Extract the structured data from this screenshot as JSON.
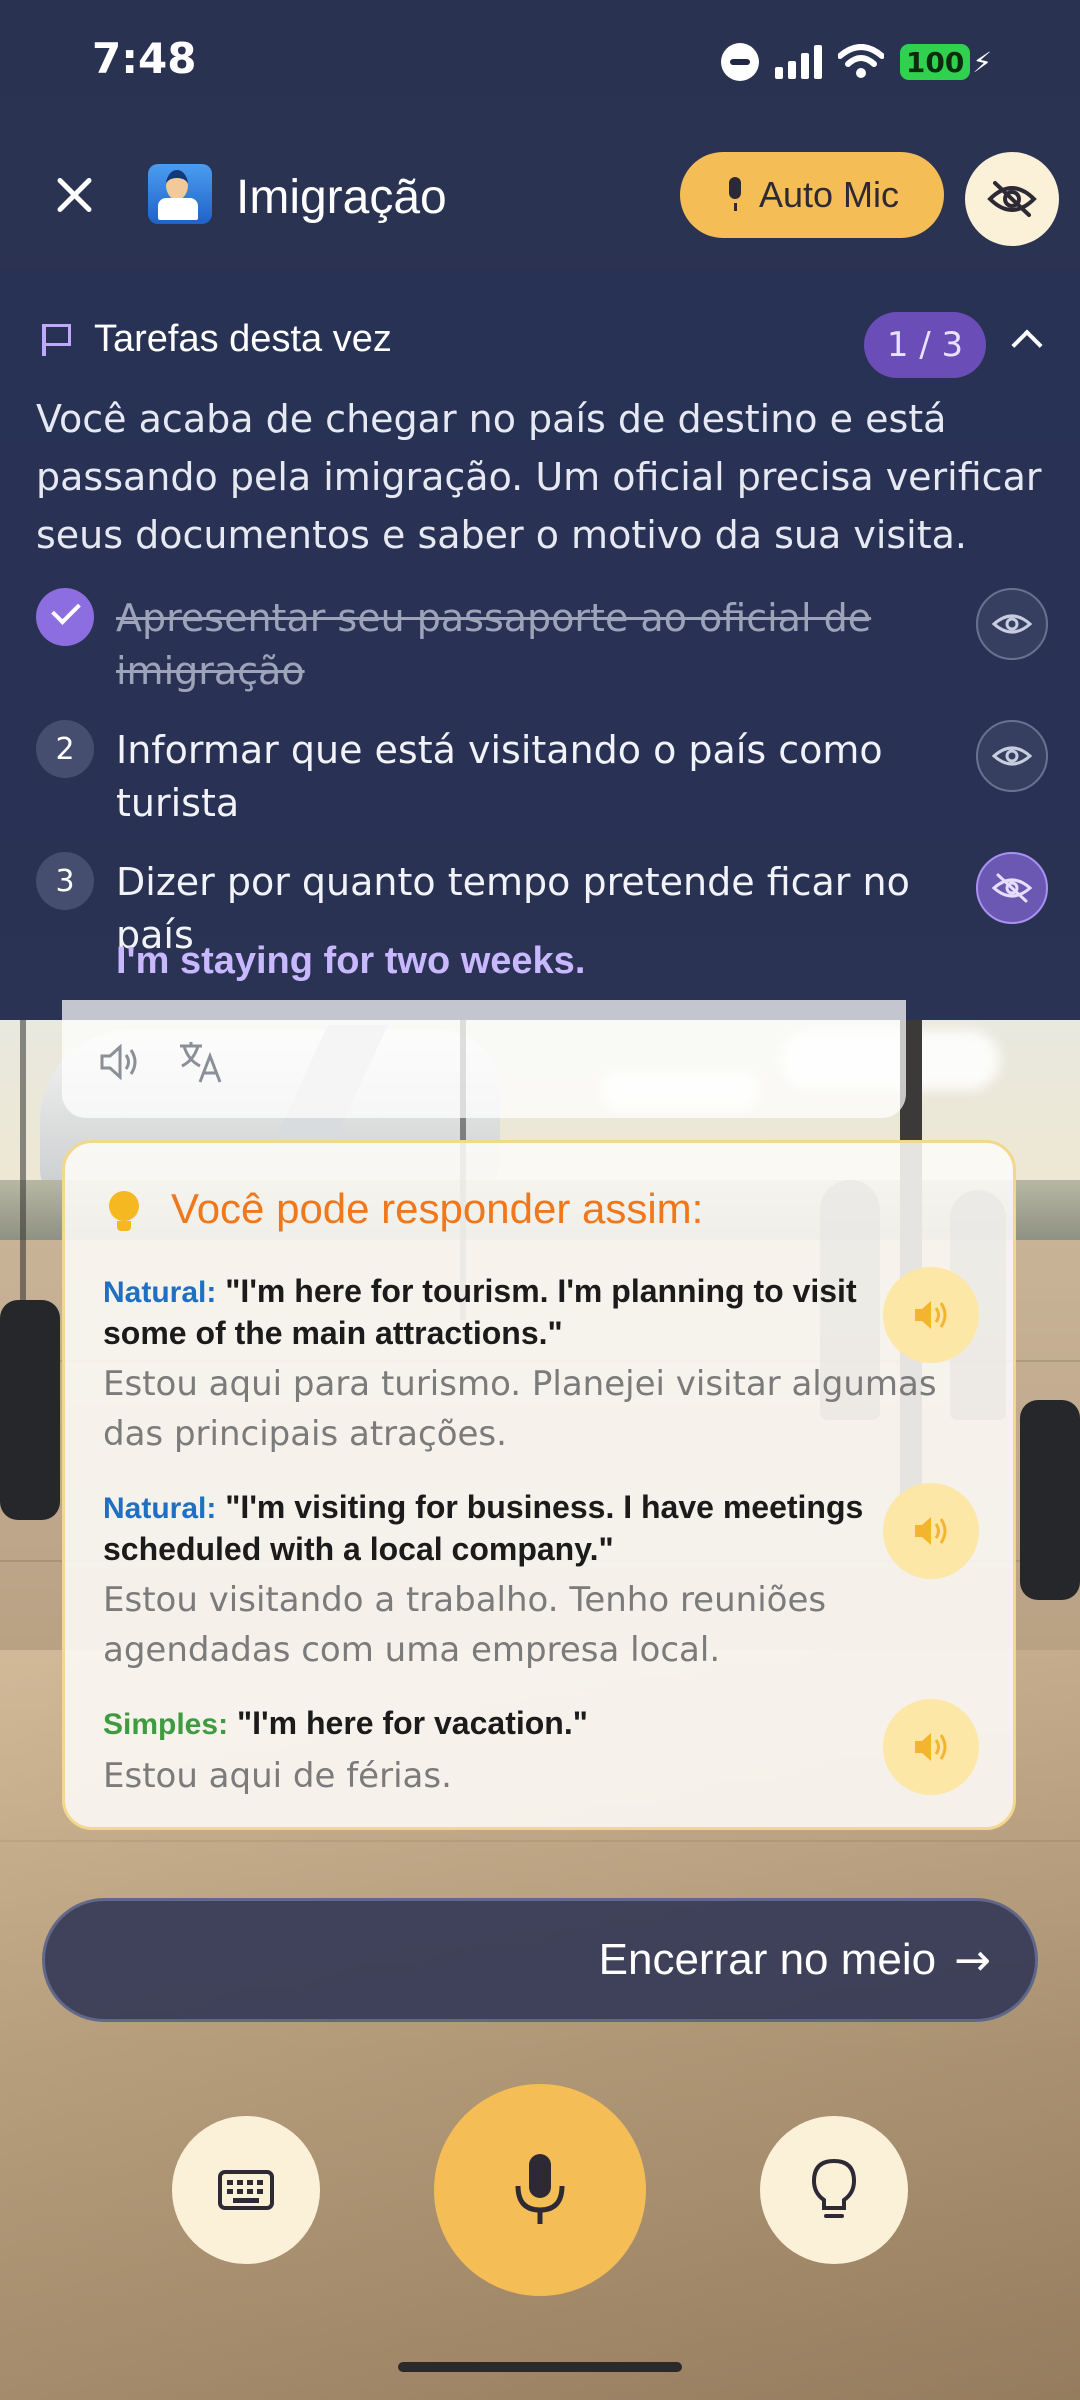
{
  "status_bar": {
    "time": "7:48",
    "battery": "100"
  },
  "header": {
    "title": "Imigração",
    "auto_mic_label": "Auto Mic"
  },
  "tasks": {
    "title": "Tarefas desta vez",
    "progress": "1 / 3",
    "description": "Você acaba de chegar no país de destino e está passando pela imigração. Um oficial precisa verificar seus documentos e saber o motivo da sua visita.",
    "items": [
      {
        "number": "1",
        "text": "Apresentar seu passaporte ao oficial de imigração",
        "done": true
      },
      {
        "number": "2",
        "text": "Informar que está visitando o país como turista",
        "done": false
      },
      {
        "number": "3",
        "text": "Dizer por quanto tempo pretende ficar no país",
        "done": false
      }
    ],
    "answer": "I'm staying for two weeks."
  },
  "suggestions": {
    "title": "Você pode responder assim:",
    "items": [
      {
        "tag": "Natural",
        "tag_sep": ":",
        "english": "\"I'm here for tourism. I'm planning to visit some of the main attractions.\"",
        "portuguese": "Estou aqui para turismo. Planejei visitar algumas das principais atrações."
      },
      {
        "tag": "Natural",
        "tag_sep": ":",
        "english": "\"I'm visiting for business. I have meetings scheduled with a local company.\"",
        "portuguese": "Estou visitando a trabalho. Tenho reuniões agendadas com uma empresa local."
      },
      {
        "tag": "Simples",
        "tag_sep": ":",
        "english": "\"I'm here for vacation.\"",
        "portuguese": "Estou aqui de férias."
      }
    ]
  },
  "end_button": {
    "label": "Encerrar no meio",
    "arrow": "→"
  },
  "colors": {
    "accent": "#f5bd55",
    "panel": "#212846",
    "purple": "#8d6ee0",
    "orange_title": "#f0771a"
  },
  "icons": [
    "close-icon",
    "passport-control-icon",
    "microphone-icon",
    "eye-off-icon",
    "flag-icon",
    "chevron-up-icon",
    "check-icon",
    "eye-icon",
    "speaker-icon",
    "translate-icon",
    "lightbulb-icon",
    "keyboard-icon"
  ]
}
